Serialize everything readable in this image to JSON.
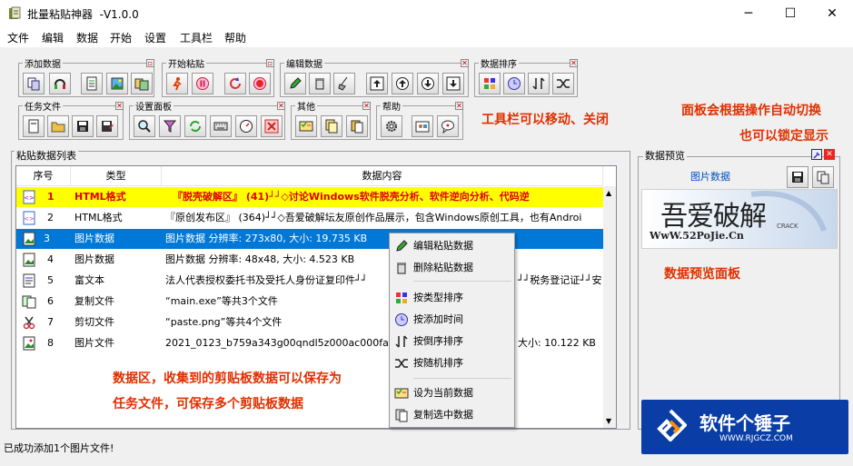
{
  "window": {
    "title": "批量粘贴神器  -V1.0.0",
    "min": "─",
    "max": "☐",
    "close": "✕"
  },
  "menu": [
    "文件",
    "编辑",
    "数据",
    "开始",
    "设置",
    "工具栏",
    "帮助"
  ],
  "toolbars": {
    "add_data": "添加数据",
    "start_paste": "开始粘贴",
    "edit_data": "编辑数据",
    "sort_data": "数据排序",
    "task_file": "任务文件",
    "settings_panel": "设置面板",
    "other": "其他",
    "help": "帮助",
    "close_x": "✕"
  },
  "notes": {
    "toolbar_note": "工具栏可以移动、关闭",
    "panel_note_1": "面板会根据操作自动切换",
    "panel_note_2": "也可以锁定显示",
    "preview_note": "数据预览面板",
    "data_note_1": "数据区，收集到的剪贴板数据可以保存为",
    "data_note_2": "任务文件，可保存多个剪贴板数据"
  },
  "list": {
    "title": "粘贴数据列表",
    "headers": [
      "序号",
      "类型",
      "数据内容"
    ],
    "rows": [
      {
        "no": "1",
        "type": "HTML格式",
        "content": "『脱壳破解区』 (41)┘┘◇讨论Windows软件脱壳分析、软件逆向分析、代码逆"
      },
      {
        "no": "2",
        "type": "HTML格式",
        "content": "『原创发布区』 (364)┘┘◇吾爱破解坛友原创作品展示，包含Windows原创工具，也有Androi"
      },
      {
        "no": "3",
        "type": "图片数据",
        "content": "图片数据 分辨率: 273x80, 大小: 19.735 KB"
      },
      {
        "no": "4",
        "type": "图片数据",
        "content": "图片数据 分辨率: 48x48, 大小: 4.523 KB"
      },
      {
        "no": "5",
        "type": "富文本",
        "content": "法人代表授权委托书及受托人身份证复印件┘┘",
        "content_tail": "┘┘税务登记证┘┘安"
      },
      {
        "no": "6",
        "type": "复制文件",
        "content": "“main.exe”等共3个文件"
      },
      {
        "no": "7",
        "type": "剪切文件",
        "content": "“paste.png”等共4个文件"
      },
      {
        "no": "8",
        "type": "图片文件",
        "content": "2021_0123_b759a343g00qndl5z000ac000fa00b4",
        "content_tail": "大小: 10.122 KB"
      }
    ]
  },
  "context_menu": [
    "编辑粘贴数据",
    "删除粘贴数据",
    "按类型排序",
    "按添加时间",
    "按倒序排序",
    "按随机排序",
    "设为当前数据",
    "复制选中数据"
  ],
  "preview": {
    "title": "数据预览",
    "label": "图片数据",
    "logo_cn": "吾爱破解",
    "logo_url": "WwW.52PoJie.Cn",
    "logo_small": "CRACK"
  },
  "watermark": {
    "name": "软件个锤子",
    "url": "WWW.RJGCZ.COM"
  },
  "status": "已成功添加1个图片文件!",
  "colors": {
    "highlight_row": "#ffff00",
    "selected_row": "#0078d7",
    "note_red": "#e03000",
    "row1_text": "#e00000"
  }
}
